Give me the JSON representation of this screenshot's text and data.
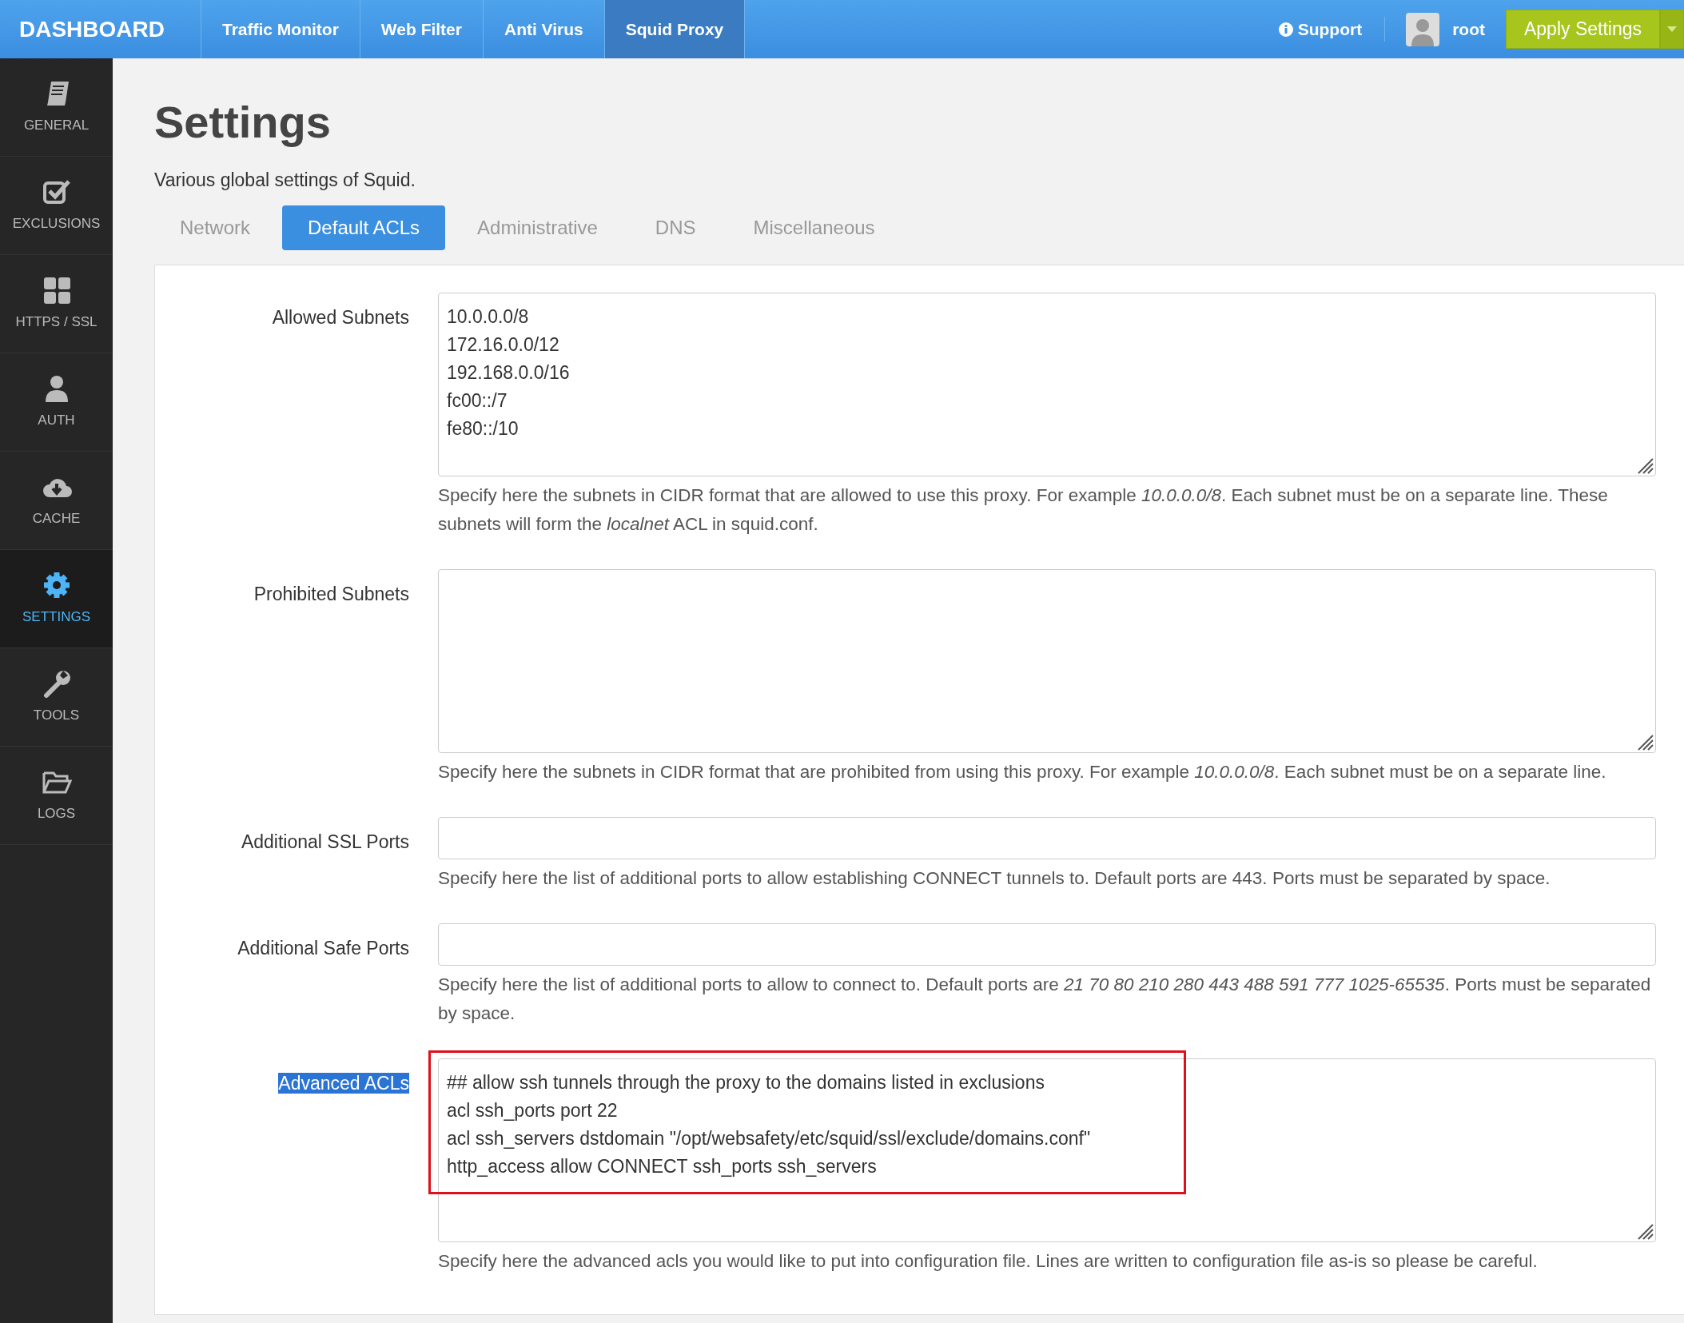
{
  "top_nav": {
    "brand": "DASHBOARD",
    "items": [
      {
        "label": "Traffic Monitor",
        "selected": false
      },
      {
        "label": "Web Filter",
        "selected": false
      },
      {
        "label": "Anti Virus",
        "selected": false
      },
      {
        "label": "Squid Proxy",
        "selected": true
      }
    ],
    "support": "Support",
    "user": "root",
    "apply_button": "Apply Settings"
  },
  "sidebar": {
    "items": [
      {
        "label": "GENERAL",
        "kind": "book",
        "selected": false
      },
      {
        "label": "EXCLUSIONS",
        "kind": "check",
        "selected": false
      },
      {
        "label": "HTTPS / SSL",
        "kind": "grid",
        "selected": false
      },
      {
        "label": "AUTH",
        "kind": "user",
        "selected": false
      },
      {
        "label": "CACHE",
        "kind": "cloud",
        "selected": false
      },
      {
        "label": "SETTINGS",
        "kind": "gear",
        "selected": true
      },
      {
        "label": "TOOLS",
        "kind": "wrench",
        "selected": false
      },
      {
        "label": "LOGS",
        "kind": "folder",
        "selected": false
      }
    ]
  },
  "page": {
    "title": "Settings",
    "subtitle": "Various global settings of Squid."
  },
  "tabs": [
    {
      "label": "Network",
      "selected": false
    },
    {
      "label": "Default ACLs",
      "selected": true
    },
    {
      "label": "Administrative",
      "selected": false
    },
    {
      "label": "DNS",
      "selected": false
    },
    {
      "label": "Miscellaneous",
      "selected": false
    }
  ],
  "fields": [
    {
      "label": "Allowed Subnets",
      "kind": "textarea",
      "lines": [
        "10.0.0.0/8",
        "172.16.0.0/12",
        "192.168.0.0/16",
        "fc00::/7",
        "fe80::/10"
      ],
      "help": "Specify here the subnets in CIDR format that are allowed to use this proxy. For example *10.0.0.0/8*. Each subnet must be on a separate line. These subnets will form the *localnet* ACL in squid.conf.",
      "label_selected": false,
      "red_outline": false
    },
    {
      "label": "Prohibited Subnets",
      "kind": "textarea",
      "help": "Specify here the subnets in CIDR format that are prohibited from using this proxy. For example *10.0.0.0/8*. Each subnet must be on a separate line.",
      "label_selected": false,
      "red_outline": false
    },
    {
      "label": "Additional SSL Ports",
      "kind": "input",
      "help": "Specify here the list of additional ports to allow establishing CONNECT tunnels to. Default ports are 443. Ports must be separated by space.",
      "label_selected": false,
      "red_outline": false
    },
    {
      "label": "Additional Safe Ports",
      "kind": "input",
      "help": "Specify here the list of additional ports to allow to connect to. Default ports are *21 70 80 210 280 443 488 591 777 1025-65535*. Ports must be separated by space.",
      "label_selected": false,
      "red_outline": false
    },
    {
      "label": "Advanced ACLs",
      "kind": "textarea",
      "lines": [
        "## allow ssh tunnels through the proxy to the domains listed in exclusions",
        "acl ssh_ports port 22",
        "acl ssh_servers dstdomain \"/opt/websafety/etc/squid/ssl/exclude/domains.conf\"",
        "http_access allow CONNECT ssh_ports ssh_servers"
      ],
      "help": "Specify here the advanced acls you would like to put into configuration file. Lines are written to configuration file as-is so please be careful.",
      "label_selected": true,
      "red_outline": true
    }
  ]
}
